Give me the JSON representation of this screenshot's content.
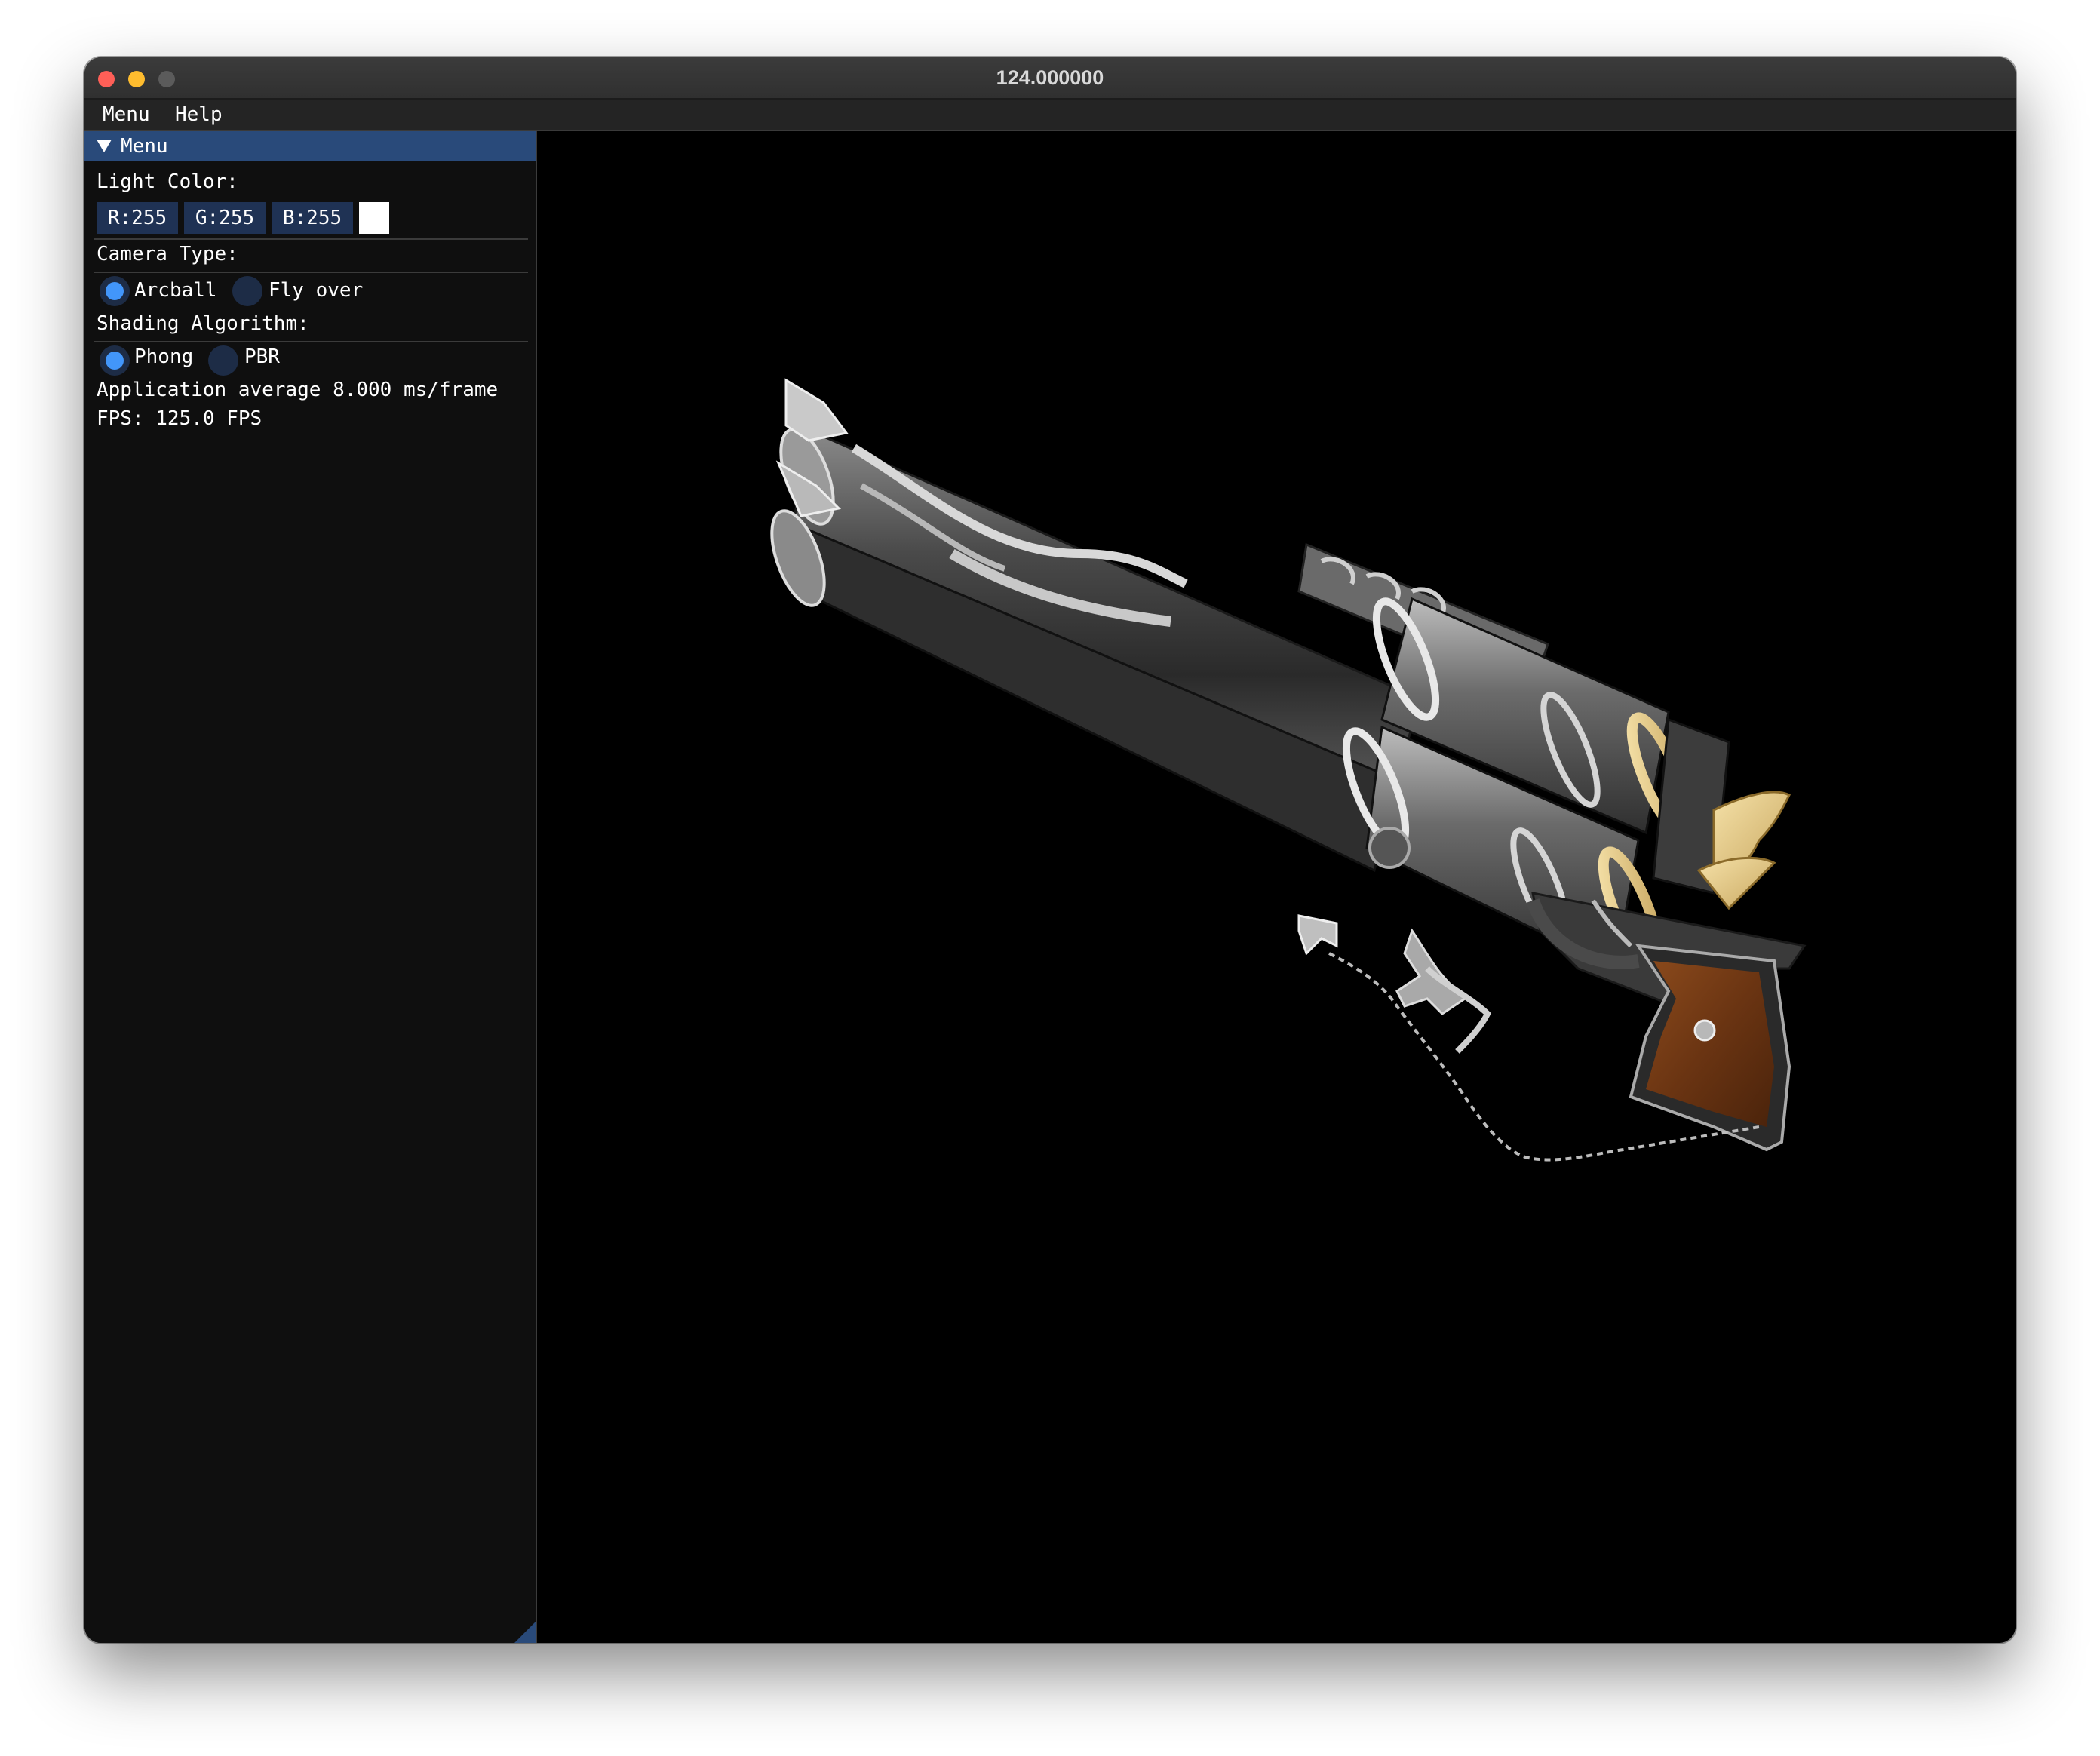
{
  "window": {
    "title": "124.000000"
  },
  "menubar": {
    "items": [
      "Menu",
      "Help"
    ]
  },
  "panel": {
    "title": "Menu",
    "light_color": {
      "label": "Light Color:",
      "r": "R:255",
      "g": "G:255",
      "b": "B:255",
      "swatch_color": "#ffffff"
    },
    "camera_type": {
      "label": "Camera Type:",
      "options": [
        {
          "label": "Arcball",
          "selected": true
        },
        {
          "label": "Fly over",
          "selected": false
        }
      ]
    },
    "shading": {
      "label": "Shading Algorithm:",
      "options": [
        {
          "label": "Phong",
          "selected": true
        },
        {
          "label": "PBR",
          "selected": false
        }
      ]
    },
    "stats": {
      "frame_time": "Application average 8.000 ms/frame",
      "fps": "FPS: 125.0 FPS"
    }
  },
  "colors": {
    "accent": "#294a7a",
    "radio_selected": "#4296fa",
    "field_bg": "#1f3254"
  }
}
